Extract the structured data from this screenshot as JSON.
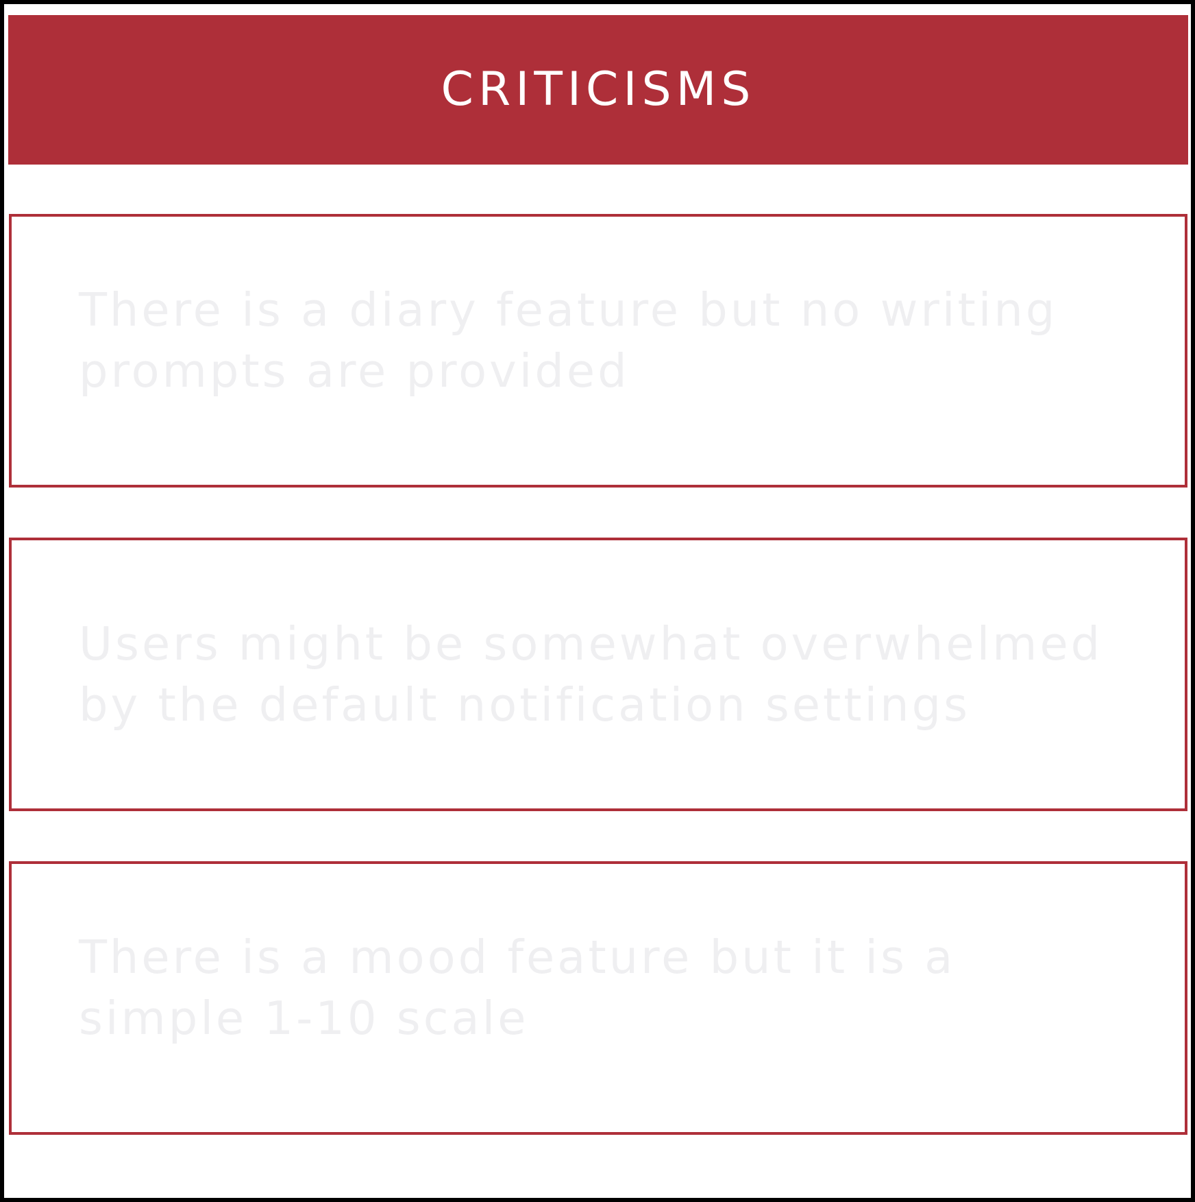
{
  "header": {
    "title": "CRITICISMS"
  },
  "criticisms": [
    {
      "text": "There is a diary feature but no writing prompts are provided"
    },
    {
      "text": "Users might be somewhat overwhelmed by the default notification settings"
    },
    {
      "text": "There is a mood feature but it is a simple 1-10 scale"
    }
  ],
  "colors": {
    "accent": "#ae2f39",
    "text_faint": "#efeff1",
    "frame": "#000000"
  }
}
